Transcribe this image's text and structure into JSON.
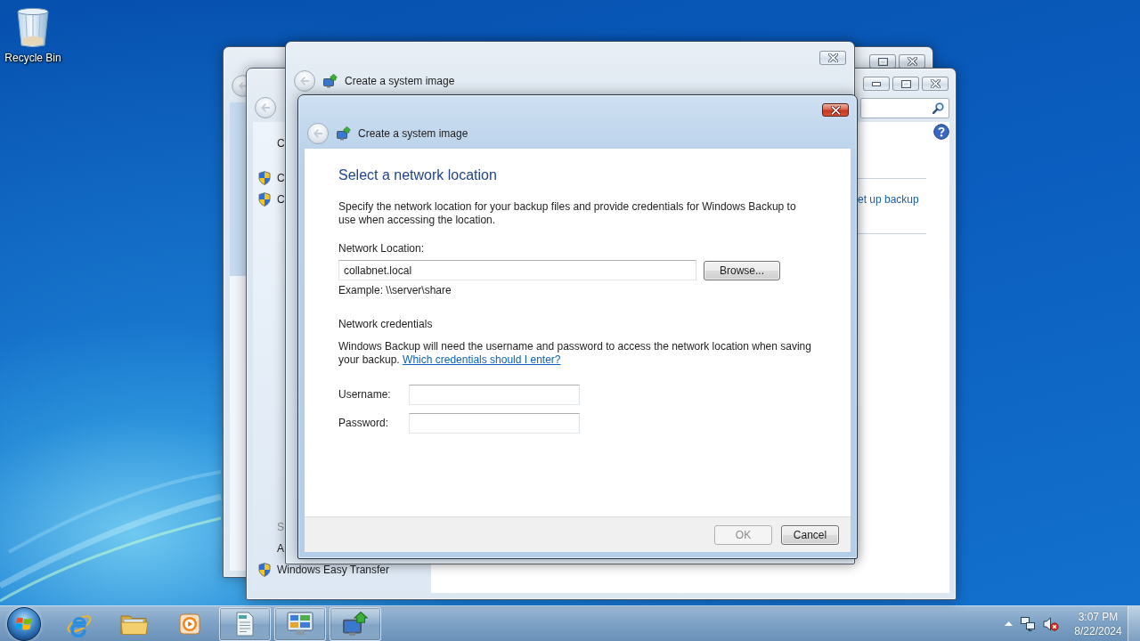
{
  "desktop_icons": [
    {
      "label": "Recycle Bin"
    }
  ],
  "background_window": {
    "back_disabled": true
  },
  "backup_window": {
    "back_disabled": true,
    "sidebar": {
      "home": "C",
      "tasks": [
        {
          "label": "C"
        },
        {
          "label": "C"
        }
      ],
      "see_also": {
        "heading": "S",
        "items": [
          {
            "label": "A",
            "kind": "plain"
          },
          {
            "label": "Windows Easy Transfer",
            "kind": "shield"
          }
        ]
      }
    },
    "link": "et up backup"
  },
  "wizard_window": {
    "title": "Create a system image",
    "back_disabled": true
  },
  "dialog": {
    "title": "Create a system image",
    "back_disabled": true,
    "heading": "Select a network location",
    "intro": "Specify the network location for your backup files and provide credentials for Windows Backup to use when accessing the location.",
    "location_label": "Network Location:",
    "location_value": "collabnet.local",
    "browse_button": "Browse...",
    "example": "Example: \\\\server\\share",
    "credentials_heading": "Network credentials",
    "credentials_text": "Windows Backup will need the username and password to access the network location when saving your backup.",
    "credentials_link": "Which credentials should I enter?",
    "fields": [
      {
        "label": "Username:"
      },
      {
        "label": "Password:"
      }
    ],
    "buttons": [
      {
        "label": "OK",
        "disabled": true
      },
      {
        "label": "Cancel",
        "disabled": false
      }
    ]
  },
  "taskbar": {
    "items": [
      {
        "kind": "browser",
        "open": false
      },
      {
        "kind": "folder",
        "open": false
      },
      {
        "kind": "media",
        "open": false
      },
      {
        "kind": "document",
        "open": true
      },
      {
        "kind": "control_panel",
        "open": true
      },
      {
        "kind": "backup",
        "open": true
      }
    ],
    "clock": {
      "time": "3:07 PM",
      "date": "8/22/2024"
    }
  }
}
